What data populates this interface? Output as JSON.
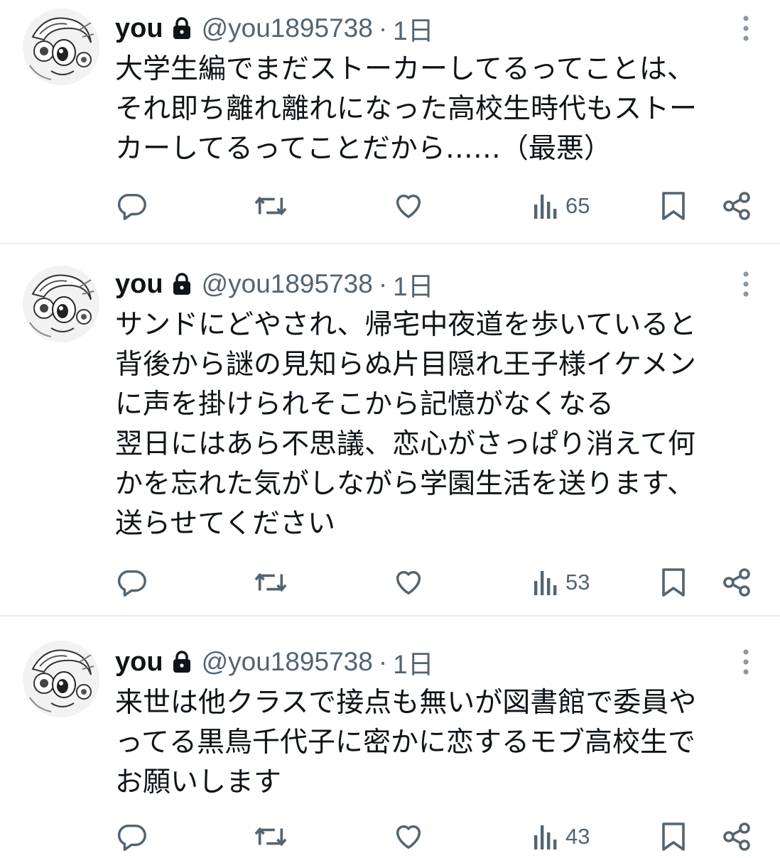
{
  "tweets": [
    {
      "name": "you",
      "handle": "@you1895738",
      "separator": "·",
      "time": "1日",
      "lines": [
        "大学生編でまだストーカーしてるってことは、",
        "それ即ち離れ離れになった高校生時代もストー",
        "カーしてるってことだから……（最悪）"
      ],
      "views": "65"
    },
    {
      "name": "you",
      "handle": "@you1895738",
      "separator": "·",
      "time": "1日",
      "lines": [
        "サンドにどやされ、帰宅中夜道を歩いていると",
        "背後から謎の見知らぬ片目隠れ王子様イケメン",
        "に声を掛けられそこから記憶がなくなる",
        "翌日にはあら不思議、恋心がさっぱり消えて何",
        "かを忘れた気がしながら学園生活を送ります、",
        "送らせてください"
      ],
      "views": "53"
    },
    {
      "name": "you",
      "handle": "@you1895738",
      "separator": "·",
      "time": "1日",
      "lines": [
        "来世は他クラスで接点も無いが図書館で委員や",
        "ってる黒鳥千代子に密かに恋するモブ高校生で",
        "お願いします"
      ],
      "views": "43"
    }
  ],
  "icons": {
    "lock": "lock-icon",
    "more": "more-vertical-icon",
    "reply": "reply-icon",
    "retweet": "retweet-icon",
    "like": "heart-icon",
    "views": "views-icon",
    "bookmark": "bookmark-icon",
    "share": "share-icon"
  },
  "colors": {
    "text": "#0f1419",
    "secondary": "#536471",
    "divider": "#e6ecf0"
  }
}
